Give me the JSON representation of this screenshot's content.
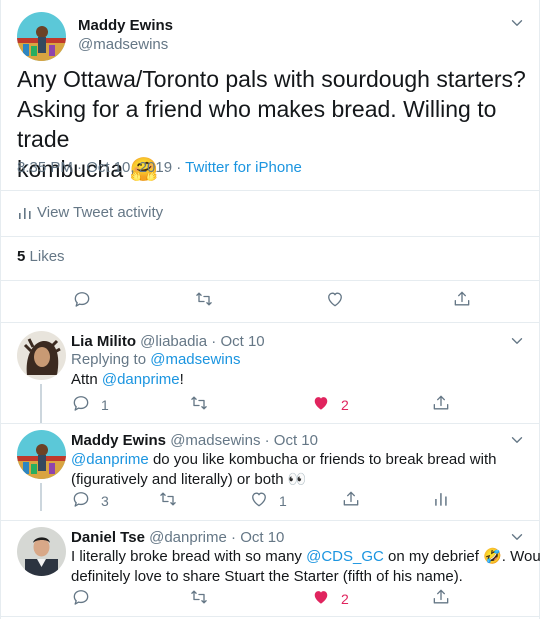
{
  "colors": {
    "link": "#1b95e0",
    "muted": "#657786",
    "like": "#e0245e",
    "divider": "#e6ecf0"
  },
  "main": {
    "author_name": "Maddy Ewins",
    "author_handle": "@madsewins",
    "text_line1": "Any Ottawa/Toronto pals with sourdough starters?",
    "text_line2": "Asking for a friend who makes bread. Willing to trade",
    "text_line3": "kombucha",
    "emoji": "🤗",
    "time": "8:35 PM · Oct 10, 2019",
    "dot": "·",
    "source": "Twitter for iPhone",
    "activity_label": "View Tweet activity",
    "likes_count": "5",
    "likes_label": "Likes"
  },
  "replies": [
    {
      "name": "Lia Milito",
      "handle": "@liabadia",
      "date": "· Oct 10",
      "replying_prefix": "Replying to",
      "replying_handle": "@madsewins",
      "text_prefix": "Attn",
      "mention": "@danprime",
      "text_suffix": "!",
      "reply_count": "1",
      "like_count": "2"
    },
    {
      "name": "Maddy Ewins",
      "handle": "@madsewins",
      "date": "· Oct 10",
      "mention": "@danprime",
      "text_line1": "do you like kombucha or friends to break bread with",
      "text_line2": "(figuratively and literally) or both",
      "eyes": "👀",
      "reply_count": "3",
      "like_count": "1"
    },
    {
      "name": "Daniel Tse",
      "handle": "@danprime",
      "date": "· Oct 10",
      "text_prefix": "I literally broke bread with so many",
      "mention": "@CDS_GC",
      "text_mid": "on my debrief",
      "emoji": "🤣",
      "text_after": ". Would",
      "text_line2": "definitely love to share Stuart the Starter (fifth of his name).",
      "like_count": "2"
    }
  ],
  "icons": [
    "chevron-down-icon",
    "reply-icon",
    "retweet-icon",
    "heart-icon",
    "share-icon",
    "analytics-icon"
  ]
}
